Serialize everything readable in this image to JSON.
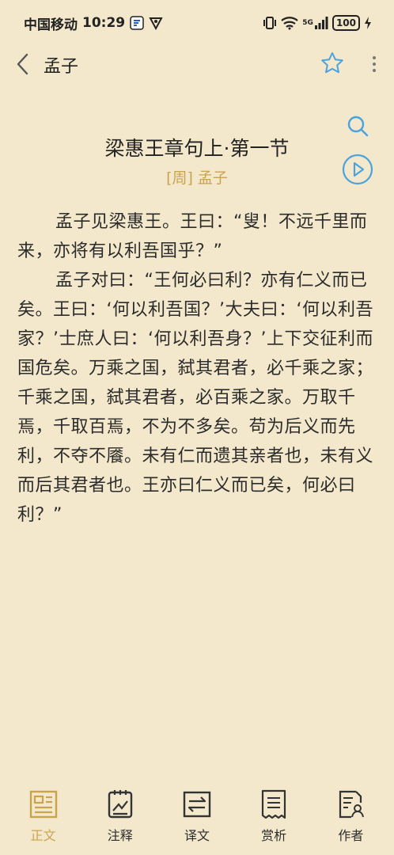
{
  "status_bar": {
    "carrier": "中国移动",
    "time": "10:29",
    "network": "5G",
    "battery": "100"
  },
  "header": {
    "title": "孟子"
  },
  "article": {
    "title": "梁惠王章句上·第一节",
    "subtitle": "[周] 孟子",
    "paragraphs": [
      "孟子见梁惠王。王曰：“叟！不远千里而来，亦将有以利吾国乎？”",
      "孟子对曰：“王何必曰利？亦有仁义而已矣。王曰：‘何以利吾国？’大夫曰：‘何以利吾家？’士庶人曰：‘何以利吾身？’上下交征利而国危矣。万乘之国，弑其君者，必千乘之家；千乘之国，弑其君者，必百乘之家。万取千焉，千取百焉，不为不多矣。苟为后义而先利，不夺不餍。未有仁而遗其亲者也，未有义而后其君者也。王亦曰仁义而已矣，何必曰利？”"
    ]
  },
  "bottom_nav": {
    "items": [
      {
        "label": "正文",
        "icon": "article-icon"
      },
      {
        "label": "注释",
        "icon": "notes-icon"
      },
      {
        "label": "译文",
        "icon": "translate-icon"
      },
      {
        "label": "赏析",
        "icon": "analysis-icon"
      },
      {
        "label": "作者",
        "icon": "author-icon"
      }
    ],
    "active_index": 0
  },
  "colors": {
    "background": "#f3e8cc",
    "accent": "#c9a44c",
    "icon_blue": "#4aa3df",
    "text": "#2b2b2b"
  }
}
